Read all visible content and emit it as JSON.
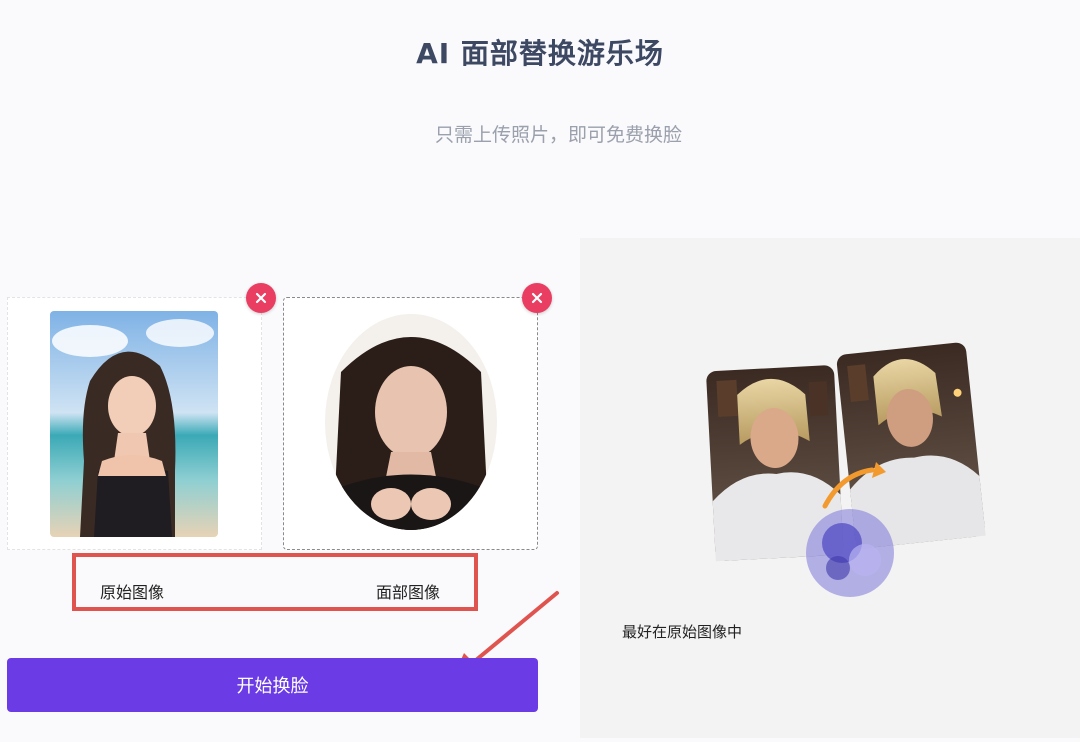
{
  "header": {
    "title": "AI 面部替换游乐场",
    "subtitle": "只需上传照片，即可免费换脸"
  },
  "upload": {
    "original_label": "原始图像",
    "face_label": "面部图像",
    "remove_icon": "close-icon"
  },
  "actions": {
    "start_label": "开始换脸"
  },
  "preview": {
    "hint": "最好在原始图像中"
  },
  "colors": {
    "primary": "#6b3ce6",
    "remove": "#ea3d62",
    "highlight": "#e0544f",
    "title": "#3d4863"
  }
}
